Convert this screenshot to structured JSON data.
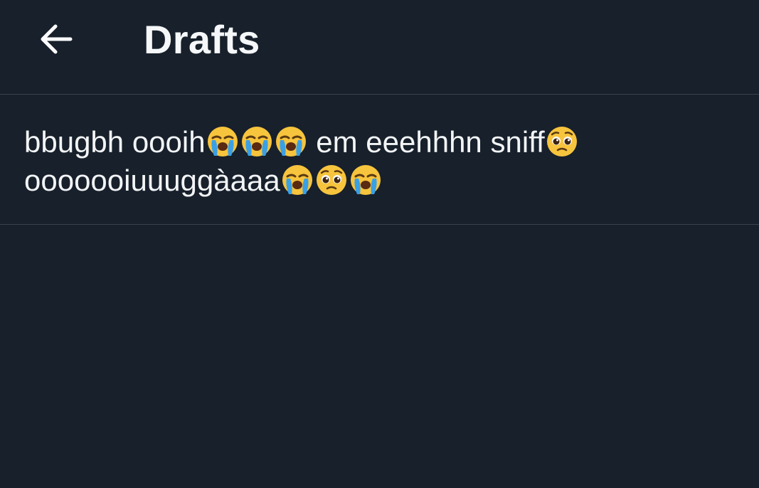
{
  "header": {
    "title": "Drafts",
    "back_icon": "arrow-left-icon"
  },
  "draft": {
    "line1_a": "bbugbh oooih",
    "line1_b": " em eeehhhn sniff",
    "line2_a": "oooooo iuuuggàaaa",
    "line2_text": "ooooooiuuuggàaaa",
    "emoji_line1_a": [
      "loudly-crying-face",
      "loudly-crying-face",
      "loudly-crying-face"
    ],
    "emoji_line1_b": [
      "pleading-face"
    ],
    "emoji_line2": [
      "loudly-crying-face",
      "pleading-face",
      "loudly-crying-face"
    ]
  },
  "colors": {
    "background": "#17202b",
    "divider": "#39434e",
    "text": "#f2f4f6",
    "emoji_yellow": "#f7c43d",
    "tear_blue": "#3aa0e6"
  }
}
